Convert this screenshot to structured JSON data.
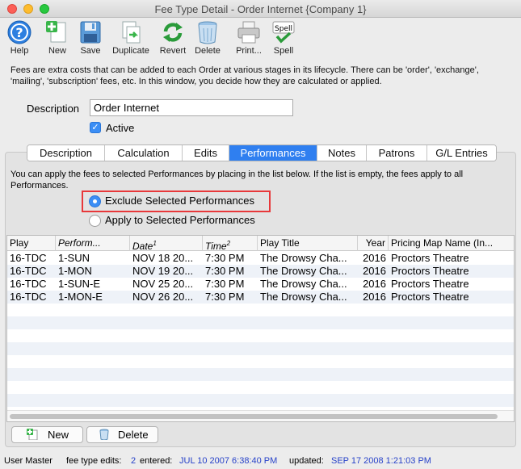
{
  "window": {
    "title": "Fee Type Detail - Order Internet {Company 1}"
  },
  "toolbar": {
    "help": "Help",
    "new": "New",
    "save": "Save",
    "duplicate": "Duplicate",
    "revert": "Revert",
    "delete": "Delete",
    "print": "Print...",
    "spell": "Spell",
    "spell_icon_text": "Spell"
  },
  "intro_text": "Fees are extra costs that can be added to each Order at various stages in its lifecycle.  There can be 'order', 'exchange', 'mailing', 'subscription' fees, etc.  In this window, you decide how they are calculated or applied.",
  "form": {
    "description_label": "Description",
    "description_value": "Order Internet",
    "active_label": "Active",
    "active_checked": true
  },
  "tabs": [
    {
      "label": "Description"
    },
    {
      "label": "Calculation"
    },
    {
      "label": "Edits"
    },
    {
      "label": "Performances",
      "active": true
    },
    {
      "label": "Notes"
    },
    {
      "label": "Patrons"
    },
    {
      "label": "G/L Entries"
    }
  ],
  "performances": {
    "info": "You can apply the fees to selected Performances by placing in the list below.  If the list is empty, the fees apply to all Performances.",
    "radio_exclude": "Exclude Selected Performances",
    "radio_apply": "Apply to Selected Performances",
    "selected_option": "exclude"
  },
  "grid": {
    "columns": {
      "play": "Play",
      "performance": "Perform...",
      "date": "Date",
      "date_sup": "1",
      "time": "Time",
      "time_sup": "2",
      "play_title": "Play Title",
      "year": "Year",
      "pricing_map": "Pricing Map Name (In..."
    },
    "rows": [
      {
        "play": "16-TDC",
        "performance": "1-SUN",
        "date": "NOV 18 20...",
        "time": "7:30 PM",
        "play_title": "The Drowsy Cha...",
        "year": "2016",
        "pricing_map": "Proctors Theatre"
      },
      {
        "play": "16-TDC",
        "performance": "1-MON",
        "date": "NOV 19 20...",
        "time": "7:30 PM",
        "play_title": "The Drowsy Cha...",
        "year": "2016",
        "pricing_map": "Proctors Theatre"
      },
      {
        "play": "16-TDC",
        "performance": "1-SUN-E",
        "date": "NOV 25 20...",
        "time": "7:30 PM",
        "play_title": "The Drowsy Cha...",
        "year": "2016",
        "pricing_map": "Proctors Theatre"
      },
      {
        "play": "16-TDC",
        "performance": "1-MON-E",
        "date": "NOV 26 20...",
        "time": "7:30 PM",
        "play_title": "The Drowsy Cha...",
        "year": "2016",
        "pricing_map": "Proctors Theatre"
      }
    ],
    "stripe_color": "#eef2f8"
  },
  "buttons": {
    "new": "New",
    "delete": "Delete"
  },
  "status": {
    "user": "User Master",
    "edits_label": "fee type edits:",
    "edits_value": "2",
    "entered_label": "entered:",
    "entered_value": "JUL 10 2007 6:38:40 PM",
    "updated_label": "updated:",
    "updated_value": "SEP 17 2008 1:21:03 PM"
  },
  "colors": {
    "accent": "#2f7ff0",
    "highlight_border": "#e8383a",
    "status_value": "#2742c9"
  },
  "icons": {
    "help": "help-icon",
    "new": "new-document-icon",
    "save": "save-disk-icon",
    "duplicate": "duplicate-icon",
    "revert": "revert-arrows-icon",
    "delete": "trash-icon",
    "print": "printer-icon",
    "spell": "spell-check-icon"
  }
}
